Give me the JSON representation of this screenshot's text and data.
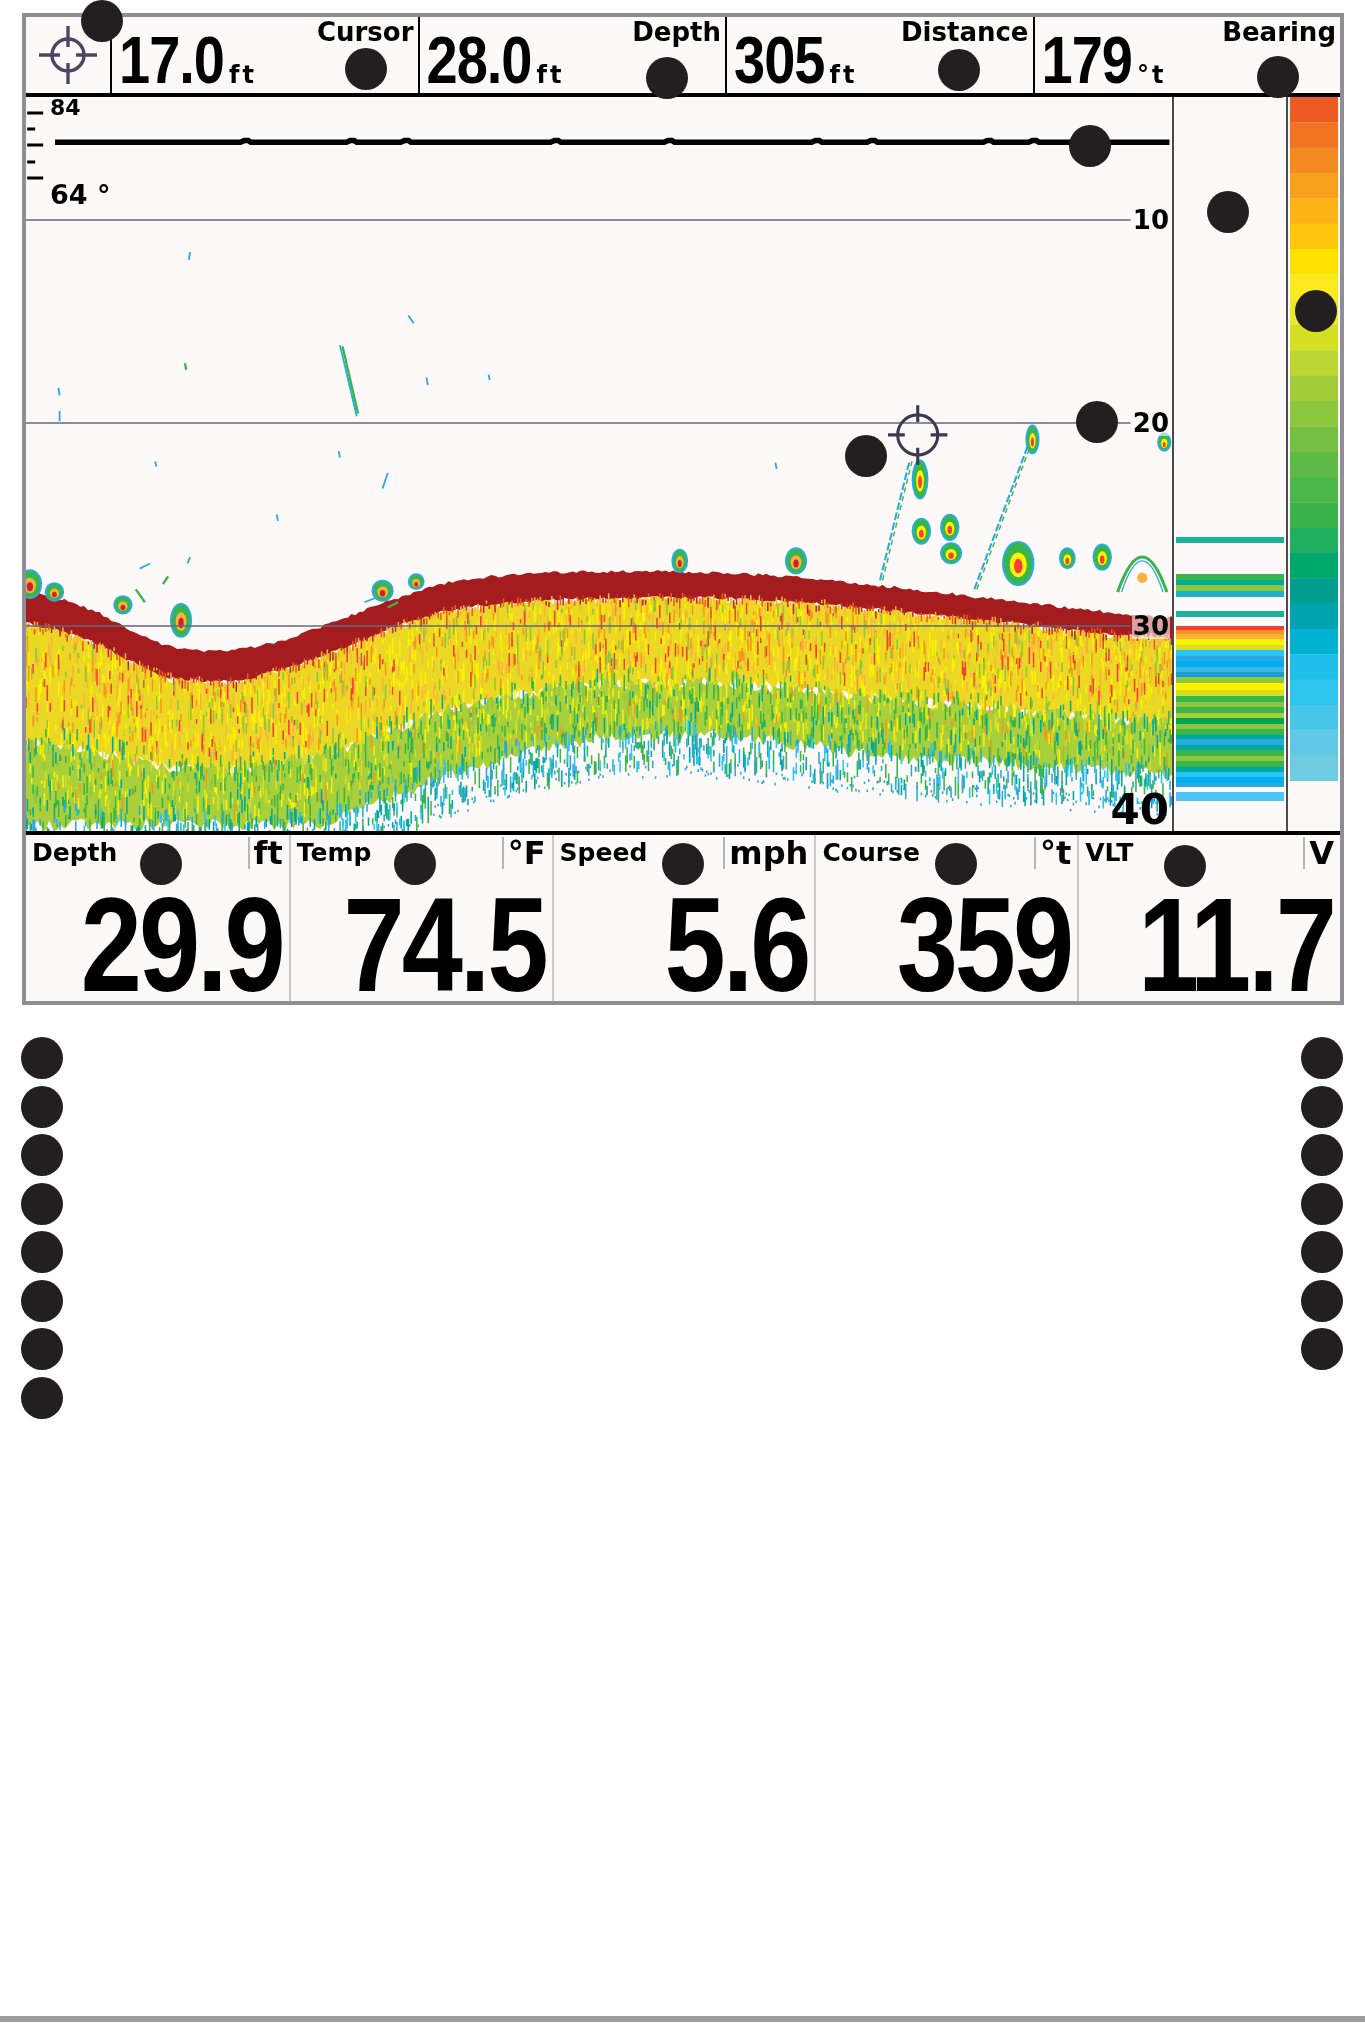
{
  "top_bar": {
    "readouts": [
      {
        "value": "17.0",
        "unit": "ft"
      },
      {
        "value": "28.0",
        "unit": "ft"
      },
      {
        "value": "305",
        "unit": "ft"
      },
      {
        "value": "179",
        "unit": "°t"
      }
    ],
    "labels": [
      "Cursor",
      "Depth",
      "Distance",
      "Bearing"
    ]
  },
  "sonar": {
    "temperature_graph": {
      "top_label": "84",
      "bottom_label": "64 °"
    },
    "depth_labels": [
      "10",
      "20",
      "30",
      "40"
    ]
  },
  "data_boxes": [
    {
      "label": "Depth",
      "unit": "ft",
      "value": "29.9"
    },
    {
      "label": "Temp",
      "unit": "°F",
      "value": "74.5"
    },
    {
      "label": "Speed",
      "unit": "mph",
      "value": "5.6"
    },
    {
      "label": "Course",
      "unit": "°t",
      "value": "359"
    },
    {
      "label": "VLT",
      "unit": "V",
      "value": "11.7"
    }
  ]
}
